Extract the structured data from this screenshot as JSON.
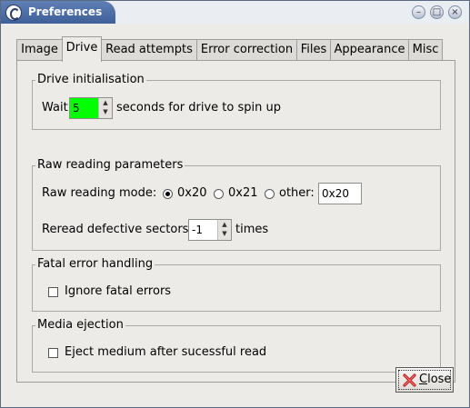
{
  "window": {
    "title": "Preferences"
  },
  "window_buttons": {
    "minimize": "–",
    "maximize": "□",
    "close": "×"
  },
  "tabs": [
    "Image",
    "Drive",
    "Read attempts",
    "Error correction",
    "Files",
    "Appearance",
    "Misc"
  ],
  "active_tab": "Drive",
  "drive_init": {
    "title": "Drive initialisation",
    "wait_label": "Wait",
    "wait_value": "5",
    "wait_suffix": "seconds for drive to spin up",
    "wait_field_color": "#00ff00"
  },
  "raw_reading": {
    "title": "Raw reading parameters",
    "mode_label": "Raw reading mode:",
    "options": [
      "0x20",
      "0x21",
      "other:"
    ],
    "selected": "0x20",
    "other_value": "0x20",
    "reread_label": "Reread defective sectors",
    "reread_value": "-1",
    "reread_suffix": "times"
  },
  "fatal": {
    "title": "Fatal error handling",
    "ignore_label": "Ignore fatal errors",
    "ignore_checked": false
  },
  "media": {
    "title": "Media ejection",
    "eject_label": "Eject medium after sucessful read",
    "eject_checked": false
  },
  "close_button": {
    "label_underlined": "C",
    "label_rest": "lose"
  },
  "colors": {
    "title_bar": "#4f6fa9",
    "close_icon": "#c02020"
  }
}
